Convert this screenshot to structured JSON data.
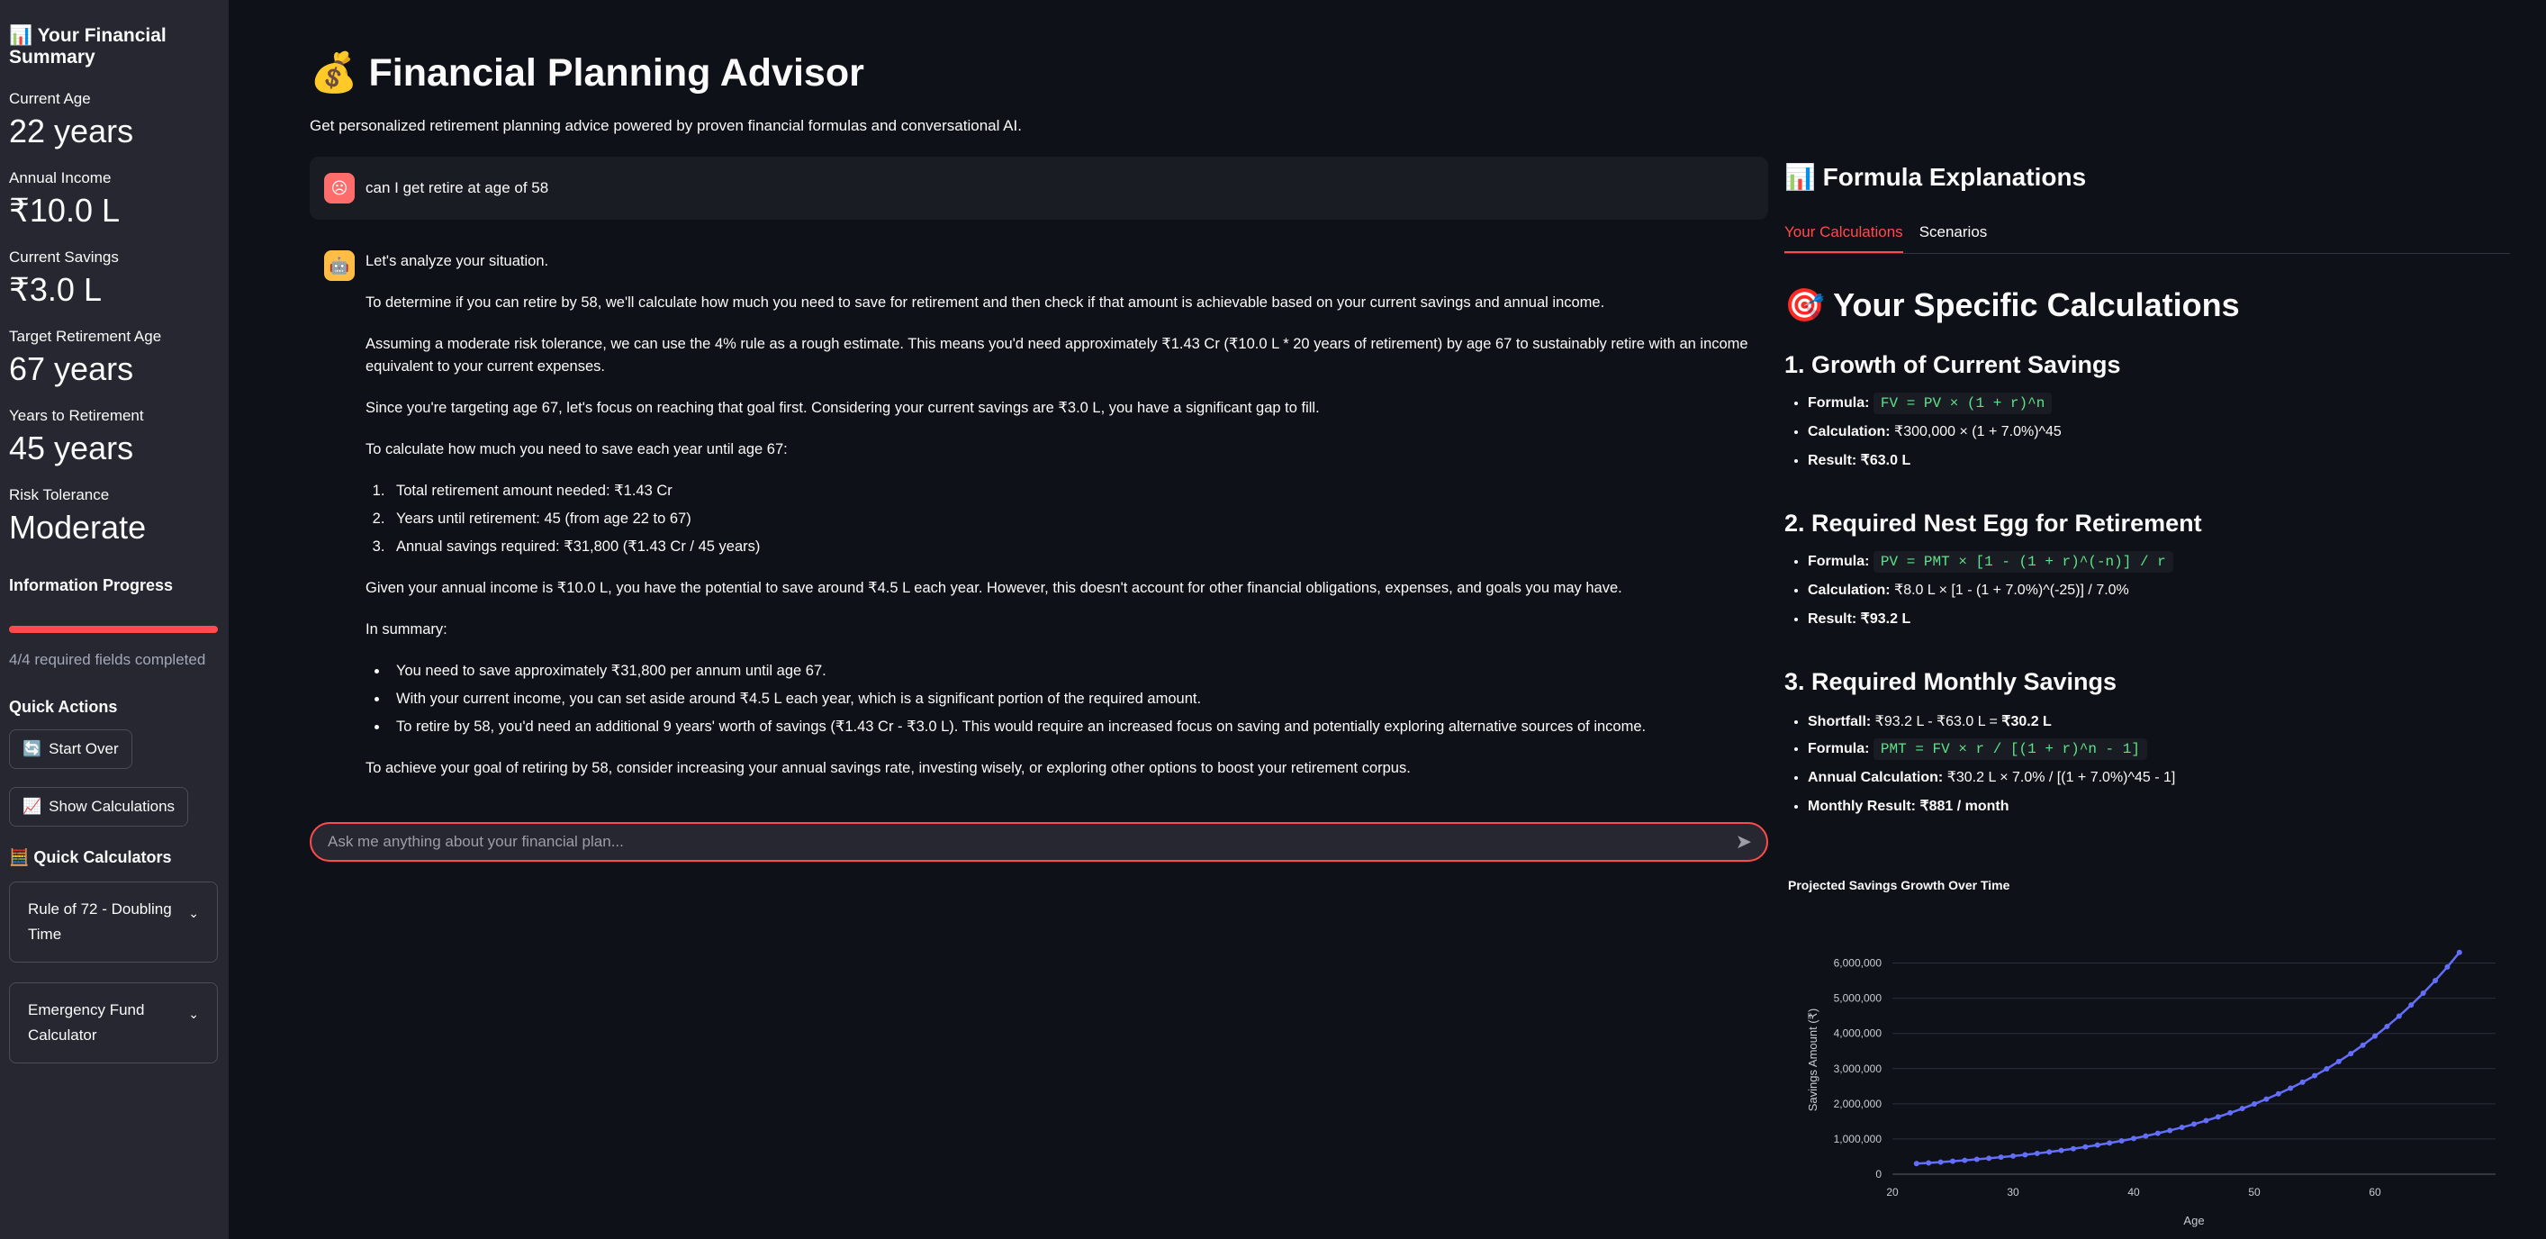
{
  "sidebar": {
    "title": "📊 Your Financial Summary",
    "metrics": [
      {
        "label": "Current Age",
        "value": "22 years"
      },
      {
        "label": "Annual Income",
        "value": "₹10.0 L"
      },
      {
        "label": "Current Savings",
        "value": "₹3.0 L"
      },
      {
        "label": "Target Retirement Age",
        "value": "67 years"
      },
      {
        "label": "Years to Retirement",
        "value": "45 years"
      },
      {
        "label": "Risk Tolerance",
        "value": "Moderate"
      }
    ],
    "progress_heading": "Information Progress",
    "progress_fraction": 1.0,
    "progress_text": "4/4 required fields completed",
    "quick_actions_heading": "Quick Actions",
    "start_over_icon": "🔄",
    "start_over_label": "Start Over",
    "show_calc_icon": "📈",
    "show_calc_label": "Show Calculations",
    "quick_calc_heading": "🧮 Quick Calculators",
    "expanders": [
      "Rule of 72 - Doubling Time",
      "Emergency Fund Calculator"
    ]
  },
  "header": {
    "title": "💰 Financial Planning Advisor",
    "subtitle": "Get personalized retirement planning advice powered by proven financial formulas and conversational AI."
  },
  "chat": {
    "user_message": "can I get retire at age of 58",
    "user_avatar": "☹",
    "bot_avatar": "🤖",
    "bot": {
      "p1": "Let's analyze your situation.",
      "p2": "To determine if you can retire by 58, we'll calculate how much you need to save for retirement and then check if that amount is achievable based on your current savings and annual income.",
      "p3": "Assuming a moderate risk tolerance, we can use the 4% rule as a rough estimate. This means you'd need approximately ₹1.43 Cr (₹10.0 L * 20 years of retirement) by age 67 to sustainably retire with an income equivalent to your current expenses.",
      "p4": "Since you're targeting age 67, let's focus on reaching that goal first. Considering your current savings are ₹3.0 L, you have a significant gap to fill.",
      "p5": "To calculate how much you need to save each year until age 67:",
      "ol": [
        "Total retirement amount needed: ₹1.43 Cr",
        "Years until retirement: 45 (from age 22 to 67)",
        "Annual savings required: ₹31,800 (₹1.43 Cr / 45 years)"
      ],
      "p6": "Given your annual income is ₹10.0 L, you have the potential to save around ₹4.5 L each year. However, this doesn't account for other financial obligations, expenses, and goals you may have.",
      "p7": "In summary:",
      "ul": [
        "You need to save approximately ₹31,800 per annum until age 67.",
        "With your current income, you can set aside around ₹4.5 L each year, which is a significant portion of the required amount.",
        "To retire by 58, you'd need an additional 9 years' worth of savings (₹1.43 Cr - ₹3.0 L). This would require an increased focus on saving and potentially exploring alternative sources of income."
      ],
      "p8": "To achieve your goal of retiring by 58, consider increasing your annual savings rate, investing wisely, or exploring other options to boost your retirement corpus."
    },
    "input_placeholder": "Ask me anything about your financial plan...",
    "send_icon": "➤"
  },
  "right": {
    "title": "📊 Formula Explanations",
    "tabs": [
      "Your Calculations",
      "Scenarios"
    ],
    "calc_title": "🎯 Your Specific Calculations",
    "sections": [
      {
        "heading": "1. Growth of Current Savings",
        "formula_label": "Formula:",
        "formula": "FV = PV × (1 + r)^n",
        "calc_label": "Calculation:",
        "calc": "₹300,000 × (1 + 7.0%)^45",
        "result_label": "Result: ₹63.0 L"
      },
      {
        "heading": "2. Required Nest Egg for Retirement",
        "formula_label": "Formula:",
        "formula": "PV = PMT × [1 - (1 + r)^(-n)] / r",
        "calc_label": "Calculation:",
        "calc": "₹8.0 L × [1 - (1 + 7.0%)^(-25)] / 7.0%",
        "result_label": "Result: ₹93.2 L"
      },
      {
        "heading": "3. Required Monthly Savings",
        "shortfall_label": "Shortfall:",
        "shortfall_eq": "₹93.2 L - ₹63.0 L = ",
        "shortfall_result": "₹30.2 L",
        "formula_label": "Formula:",
        "formula": "PMT = FV × r / [(1 + r)^n - 1]",
        "annual_label": "Annual Calculation:",
        "annual": "₹30.2 L × 7.0% / [(1 + 7.0%)^45 - 1]",
        "monthly_label": "Monthly Result: ₹881 / month"
      }
    ]
  },
  "chart_data": {
    "type": "line",
    "title": "Projected Savings Growth Over Time",
    "xlabel": "Age",
    "ylabel": "Savings Amount (₹)",
    "xlim": [
      20,
      70
    ],
    "ylim": [
      0,
      6500000
    ],
    "xticks": [
      20,
      30,
      40,
      50,
      60
    ],
    "yticks": [
      0,
      1000000,
      2000000,
      3000000,
      4000000,
      5000000,
      6000000
    ],
    "ytick_labels": [
      "0",
      "1,000,000",
      "2,000,000",
      "3,000,000",
      "4,000,000",
      "5,000,000",
      "6,000,000"
    ],
    "color": "#636efa",
    "x": [
      22,
      23,
      24,
      25,
      26,
      27,
      28,
      29,
      30,
      31,
      32,
      33,
      34,
      35,
      36,
      37,
      38,
      39,
      40,
      41,
      42,
      43,
      44,
      45,
      46,
      47,
      48,
      49,
      50,
      51,
      52,
      53,
      54,
      55,
      56,
      57,
      58,
      59,
      60,
      61,
      62,
      63,
      64,
      65,
      66,
      67
    ],
    "y": [
      300000,
      321000,
      343470,
      367513,
      393239,
      420766,
      450219,
      481734,
      515456,
      551538,
      590146,
      631456,
      675658,
      722954,
      773561,
      827710,
      885649,
      947645,
      1013980,
      1084959,
      1160906,
      1242169,
      1329121,
      1422159,
      1521710,
      1628230,
      1742206,
      1864160,
      1994652,
      2134277,
      2283676,
      2443533,
      2614580,
      2797601,
      2993433,
      3202973,
      3427181,
      3667084,
      3923780,
      4198444,
      4492335,
      4806799,
      5143275,
      5503304,
      5888536,
      6300733
    ]
  }
}
